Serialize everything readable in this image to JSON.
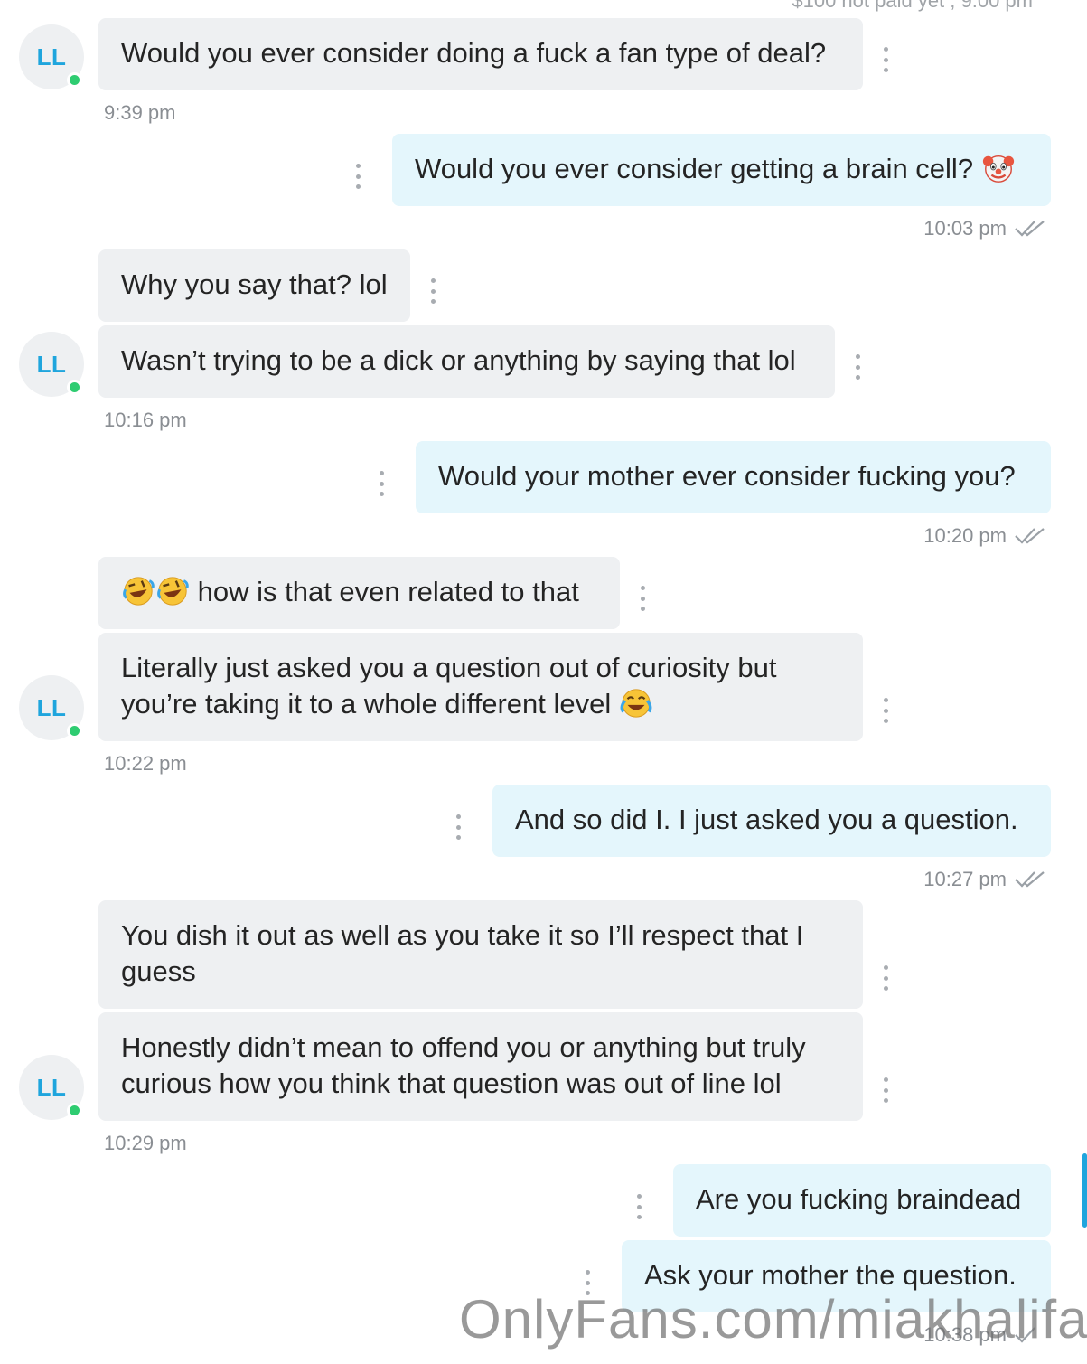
{
  "top_status": "$100 not paid yet , 9:00 pm",
  "contact": {
    "initials": "LL",
    "status_color": "#2ecc71"
  },
  "colors": {
    "incoming_bubble": "#eef0f2",
    "outgoing_bubble": "#e4f6fc",
    "accent": "#1fa5dd"
  },
  "messages": [
    {
      "dir": "in",
      "text": "Would you ever consider doing a fuck a fan type of deal?"
    },
    {
      "dir": "out",
      "text": "Would you ever consider getting a brain cell?",
      "emoji": "clown-face"
    },
    {
      "dir": "in",
      "text": "Why you say that? lol"
    },
    {
      "dir": "in",
      "text": "Wasn’t trying to be a dick or anything by saying that lol"
    },
    {
      "dir": "out",
      "text": "Would your mother ever consider fucking you?"
    },
    {
      "dir": "in",
      "text": "how is that even related to that",
      "emoji": "rolling-on-floor-laughing x2"
    },
    {
      "dir": "in",
      "text": "Literally just asked you a question out of curiosity but you’re taking it to a whole different level",
      "emoji": "tears-of-joy"
    },
    {
      "dir": "out",
      "text": "And so did I. I just asked you a question."
    },
    {
      "dir": "in",
      "text": "You dish it out as well as you take it so I’ll respect that I guess"
    },
    {
      "dir": "in",
      "text": "Honestly didn’t mean to offend you or anything but truly curious how you think that question was out of line lol"
    },
    {
      "dir": "out",
      "text": "Are you fucking braindead"
    },
    {
      "dir": "out",
      "text": "Ask your mother the question."
    }
  ],
  "timestamps": [
    "9:39 pm",
    "10:03 pm",
    "10:16 pm",
    "10:20 pm",
    "10:22 pm",
    "10:27 pm",
    "10:29 pm",
    "10:38 pm"
  ],
  "watermark": "OnlyFans.com/miakhalifa"
}
